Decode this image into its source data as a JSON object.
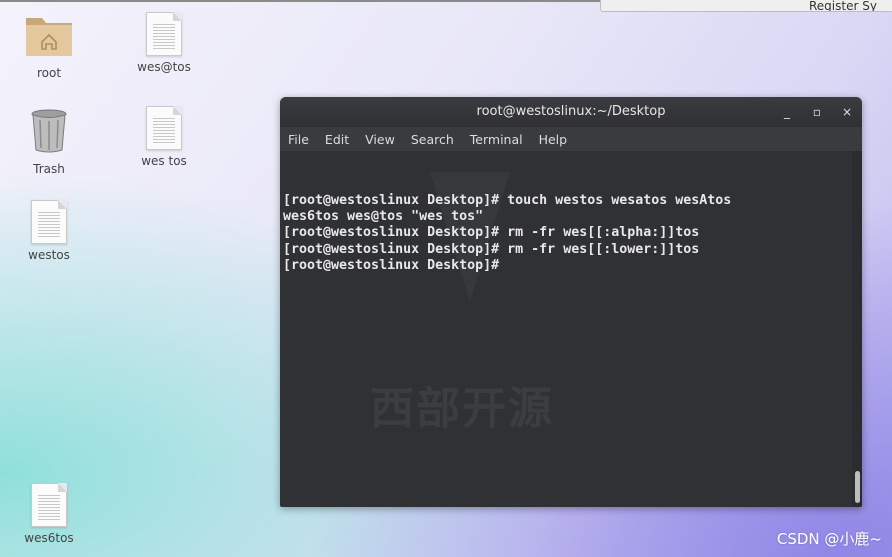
{
  "notification": {
    "text": "Register Sy"
  },
  "desktop": {
    "icons": [
      {
        "label": "root",
        "icon": "home-folder-icon"
      },
      {
        "label": "wes@tos",
        "icon": "text-file-icon"
      },
      {
        "label": "Trash",
        "icon": "trash-icon"
      },
      {
        "label": "wes tos",
        "icon": "text-file-icon"
      },
      {
        "label": "westos",
        "icon": "text-file-icon"
      },
      {
        "label": "wes6tos",
        "icon": "text-file-icon"
      }
    ]
  },
  "terminal": {
    "title": "root@westoslinux:~/Desktop",
    "buttons": {
      "minimize": "_",
      "maximize": "▫",
      "close": "×"
    },
    "menu": [
      "File",
      "Edit",
      "View",
      "Search",
      "Terminal",
      "Help"
    ],
    "lines": [
      "[root@westoslinux Desktop]# touch westos wesatos wesAtos",
      "wes6tos wes@tos \"wes tos\"",
      "[root@westoslinux Desktop]# rm -fr wes[[:alpha:]]tos",
      "[root@westoslinux Desktop]# rm -fr wes[[:lower:]]tos",
      "[root@westoslinux Desktop]# "
    ],
    "watermark": "西部开源"
  },
  "csdn_watermark": "CSDN @小鹿~",
  "colors": {
    "terminal_bg": "#303135",
    "titlebar": "#2f3034",
    "text": "#e8e8e8"
  }
}
